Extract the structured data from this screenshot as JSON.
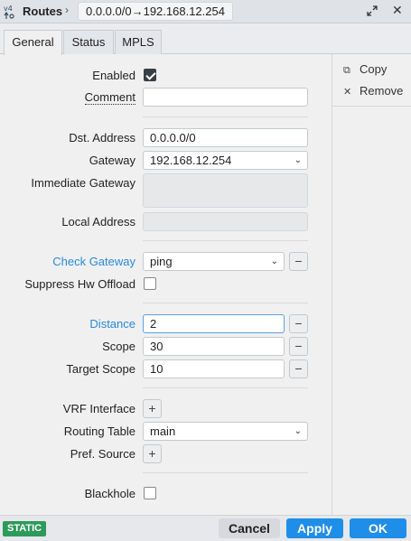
{
  "titlebar": {
    "title": "Routes",
    "path": "0.0.0.0/0→192.168.12.254"
  },
  "tabs": [
    {
      "label": "General"
    },
    {
      "label": "Status"
    },
    {
      "label": "MPLS"
    }
  ],
  "side": {
    "copy": "Copy",
    "remove": "Remove"
  },
  "form": {
    "enabled_label": "Enabled",
    "enabled_checked": true,
    "comment_label": "Comment",
    "comment_value": "",
    "dst_label": "Dst. Address",
    "dst_value": "0.0.0.0/0",
    "gateway_label": "Gateway",
    "gateway_value": "192.168.12.254",
    "immediate_label": "Immediate Gateway",
    "local_label": "Local Address",
    "checkgw_label": "Check Gateway",
    "checkgw_value": "ping",
    "suppress_label": "Suppress Hw Offload",
    "suppress_checked": false,
    "distance_label": "Distance",
    "distance_value": "2",
    "scope_label": "Scope",
    "scope_value": "30",
    "target_label": "Target Scope",
    "target_value": "10",
    "vrf_label": "VRF Interface",
    "table_label": "Routing Table",
    "table_value": "main",
    "pref_label": "Pref. Source",
    "blackhole_label": "Blackhole",
    "blackhole_checked": false
  },
  "footer": {
    "badge": "STATIC",
    "cancel": "Cancel",
    "apply": "Apply",
    "ok": "OK"
  },
  "icons": {
    "route": "route-icon",
    "expand": "expand-icon",
    "close": "close-icon",
    "copy": "copy-icon",
    "remove": "remove-icon",
    "dropdown": "chevron-down-icon",
    "minus": "minus-icon",
    "plus": "plus-icon"
  },
  "colors": {
    "accent": "#1e8ee8",
    "label_accent": "#2b8ad9",
    "badge": "#2e9a5a"
  }
}
